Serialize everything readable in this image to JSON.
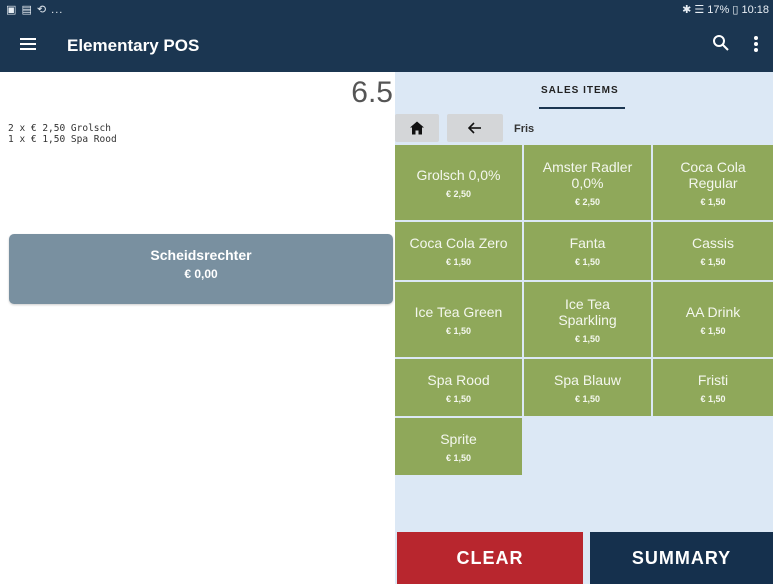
{
  "status_bar": {
    "left_icons": "▣ ▤ ⟲ ...",
    "right_text": "✱ ☰ 17% ▯ 10:18"
  },
  "app_bar": {
    "title": "Elementary POS",
    "menu_icon": "hamburger-icon",
    "search_icon": "search-icon",
    "more_icon": "more-vertical-icon"
  },
  "order": {
    "total": "6.5",
    "lines": [
      "2 x € 2,50 Grolsch",
      "1 x € 1,50 Spa Rood"
    ],
    "customer": {
      "name": "Scheidsrechter",
      "amount": "€ 0,00"
    }
  },
  "sales_panel": {
    "tab_label": "SALES ITEMS",
    "breadcrumb": "Fris",
    "home_icon": "home-icon",
    "back_icon": "arrow-left-icon",
    "items": [
      {
        "name": "Grolsch 0,0%",
        "price": "€ 2,50"
      },
      {
        "name": "Amster Radler 0,0%",
        "price": "€ 2,50"
      },
      {
        "name": "Coca Cola Regular",
        "price": "€ 1,50"
      },
      {
        "name": "Coca Cola Zero",
        "price": "€ 1,50"
      },
      {
        "name": "Fanta",
        "price": "€ 1,50"
      },
      {
        "name": "Cassis",
        "price": "€ 1,50"
      },
      {
        "name": "Ice Tea Green",
        "price": "€ 1,50"
      },
      {
        "name": "Ice Tea Sparkling",
        "price": "€ 1,50"
      },
      {
        "name": "AA Drink",
        "price": "€ 1,50"
      },
      {
        "name": "Spa Rood",
        "price": "€ 1,50"
      },
      {
        "name": "Spa Blauw",
        "price": "€ 1,50"
      },
      {
        "name": "Fristi",
        "price": "€ 1,50"
      },
      {
        "name": "Sprite",
        "price": "€ 1,50"
      }
    ]
  },
  "actions": {
    "clear_label": "CLEAR",
    "summary_label": "SUMMARY"
  },
  "colors": {
    "app_bar": "#1b3651",
    "tile": "#8fa85a",
    "clear": "#b8262e",
    "summary": "#15304d",
    "customer_button": "#7990a0",
    "panel_background": "#dce8f5"
  }
}
